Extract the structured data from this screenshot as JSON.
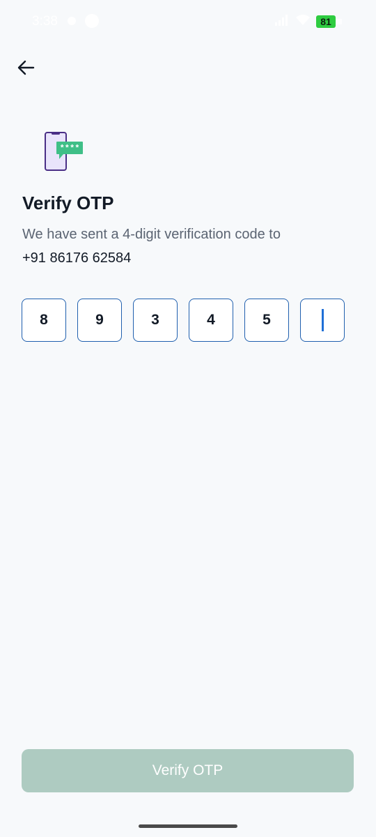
{
  "status_bar": {
    "time": "3:38",
    "battery": "81",
    "icons": [
      "notification-dot-icon",
      "circle-icon",
      "signal-icon",
      "wifi-icon",
      "battery-icon"
    ]
  },
  "header": {
    "back_icon": "arrow-left-icon"
  },
  "illustration": {
    "icon": "phone-otp-message-icon",
    "mask_text": "****"
  },
  "main": {
    "title": "Verify OTP",
    "subtitle": "We have sent a 4-digit verification code to",
    "phone": "+91 86176 62584"
  },
  "otp": {
    "digits": [
      "8",
      "9",
      "3",
      "4",
      "5",
      ""
    ],
    "active_index": 5
  },
  "footer": {
    "verify_label": "Verify OTP"
  },
  "colors": {
    "background": "#f7f9fb",
    "title": "#121a26",
    "subtitle": "#5b6472",
    "otp_border": "#1f5fae",
    "caret": "#1f6fd6",
    "button_disabled": "#aecbc1",
    "illustration_green": "#3fbf87",
    "illustration_purple": "#4a2f86"
  }
}
